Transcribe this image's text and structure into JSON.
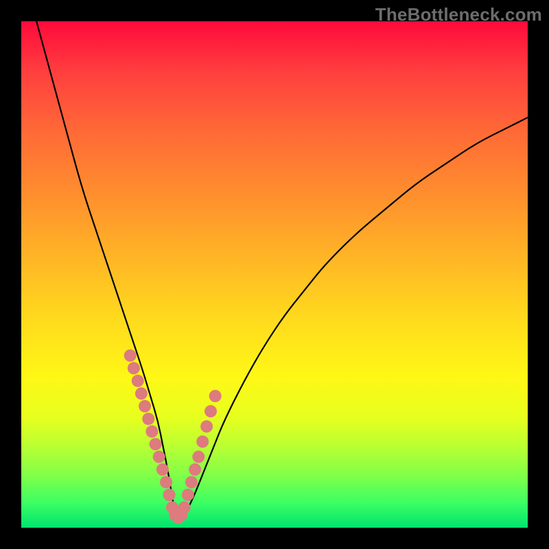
{
  "watermark": "TheBottleneck.com",
  "chart_data": {
    "type": "line",
    "title": "",
    "xlabel": "",
    "ylabel": "",
    "xlim": [
      0,
      100
    ],
    "ylim": [
      0,
      100
    ],
    "series": [
      {
        "name": "bottleneck-curve",
        "x": [
          3,
          6,
          9,
          12,
          15,
          18,
          20,
          22,
          24,
          25.5,
          27,
          28,
          29,
          29.8,
          30.5,
          32,
          34,
          36,
          38,
          40,
          44,
          48,
          52,
          56,
          60,
          66,
          72,
          78,
          84,
          90,
          96,
          100
        ],
        "y": [
          100,
          89,
          78,
          67,
          58,
          49,
          43,
          37,
          31,
          26,
          21,
          16,
          11,
          6,
          2,
          2,
          6,
          11,
          16,
          21,
          29,
          36,
          42,
          47,
          52,
          58,
          63,
          68,
          72,
          76,
          79,
          81
        ]
      }
    ],
    "markers": {
      "name": "highlight-points",
      "color": "#dd7b7e",
      "radius_px": 9,
      "x": [
        21.5,
        22.2,
        23.0,
        23.7,
        24.4,
        25.1,
        25.8,
        26.5,
        27.2,
        27.9,
        28.6,
        29.2,
        29.8,
        30.4,
        31.0,
        31.6,
        32.2,
        32.9,
        33.6,
        34.3,
        35.0,
        35.8,
        36.6,
        37.4,
        38.3
      ],
      "y": [
        34.0,
        31.5,
        29.0,
        26.5,
        24.0,
        21.5,
        19.0,
        16.5,
        14.0,
        11.5,
        9.0,
        6.5,
        4.0,
        2.5,
        2.0,
        2.5,
        4.0,
        6.5,
        9.0,
        11.5,
        14.0,
        17.0,
        20.0,
        23.0,
        26.0
      ]
    },
    "gradient_stops": [
      {
        "pos": 0.0,
        "color": "#ff0a3a"
      },
      {
        "pos": 0.1,
        "color": "#ff3f3f"
      },
      {
        "pos": 0.22,
        "color": "#ff6a36"
      },
      {
        "pos": 0.34,
        "color": "#ff8e2e"
      },
      {
        "pos": 0.46,
        "color": "#ffb326"
      },
      {
        "pos": 0.58,
        "color": "#ffd81e"
      },
      {
        "pos": 0.7,
        "color": "#fff716"
      },
      {
        "pos": 0.78,
        "color": "#e8ff1e"
      },
      {
        "pos": 0.84,
        "color": "#b9ff32"
      },
      {
        "pos": 0.9,
        "color": "#7dff4a"
      },
      {
        "pos": 0.95,
        "color": "#3dff63"
      },
      {
        "pos": 1.0,
        "color": "#00e36e"
      }
    ]
  }
}
